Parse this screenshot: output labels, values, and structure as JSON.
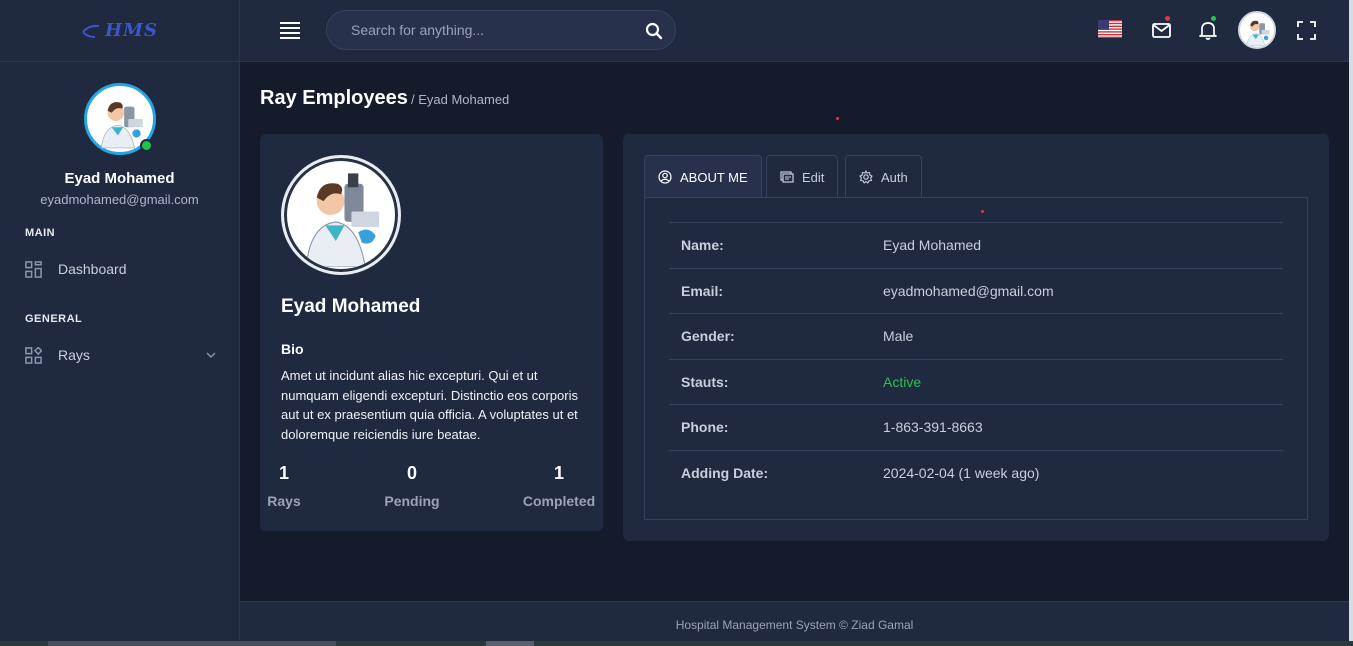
{
  "app": {
    "logo_text": "HMS"
  },
  "sidebar": {
    "user_name": "Eyad Mohamed",
    "user_email": "eyadmohamed@gmail.com",
    "sections": [
      {
        "heading": "MAIN",
        "items": [
          {
            "label": "Dashboard",
            "icon": "dashboard-icon"
          }
        ]
      },
      {
        "heading": "GENERAL",
        "items": [
          {
            "label": "Rays",
            "icon": "apps-icon",
            "expandable": true
          }
        ]
      }
    ]
  },
  "topbar": {
    "search_placeholder": "Search for anything...",
    "language_flag": "us-flag-icon",
    "mail_badge_color": "#e0383e",
    "notification_badge_color": "#1ec44b"
  },
  "page": {
    "title": "Ray Employees",
    "breadcrumb": "/ Eyad Mohamed"
  },
  "profile_card": {
    "name": "Eyad Mohamed",
    "bio_heading": "Bio",
    "bio_text": "Amet ut incidunt alias hic excepturi. Qui et ut numquam eligendi excepturi. Distinctio eos corporis aut ut ex praesentium quia officia. A voluptates ut et doloremque reiciendis iure beatae.",
    "stats": [
      {
        "value": "1",
        "label": "Rays"
      },
      {
        "value": "0",
        "label": "Pending"
      },
      {
        "value": "1",
        "label": "Completed"
      }
    ]
  },
  "details_card": {
    "tabs": [
      {
        "label": "ABOUT ME",
        "icon": "user-circle-icon",
        "active": true
      },
      {
        "label": "Edit",
        "icon": "edit-icon",
        "active": false
      },
      {
        "label": "Auth",
        "icon": "gear-icon",
        "active": false
      }
    ],
    "rows": [
      {
        "key": "Name:",
        "value": "Eyad Mohamed"
      },
      {
        "key": "Email:",
        "value": "eyadmohamed@gmail.com"
      },
      {
        "key": "Gender:",
        "value": "Male"
      },
      {
        "key": "Stauts:",
        "value": "Active",
        "status_color": "#2bc14e"
      },
      {
        "key": "Phone:",
        "value": "1-863-391-8663"
      },
      {
        "key": "Adding Date:",
        "value": "2024-02-04 (1 week ago)"
      }
    ]
  },
  "footer": {
    "text": "Hospital Management System © Ziad Gamal"
  },
  "colors": {
    "accent": "#26a5e4",
    "background": "#161b2b",
    "panel": "#1f2940",
    "online": "#1ec44b"
  }
}
